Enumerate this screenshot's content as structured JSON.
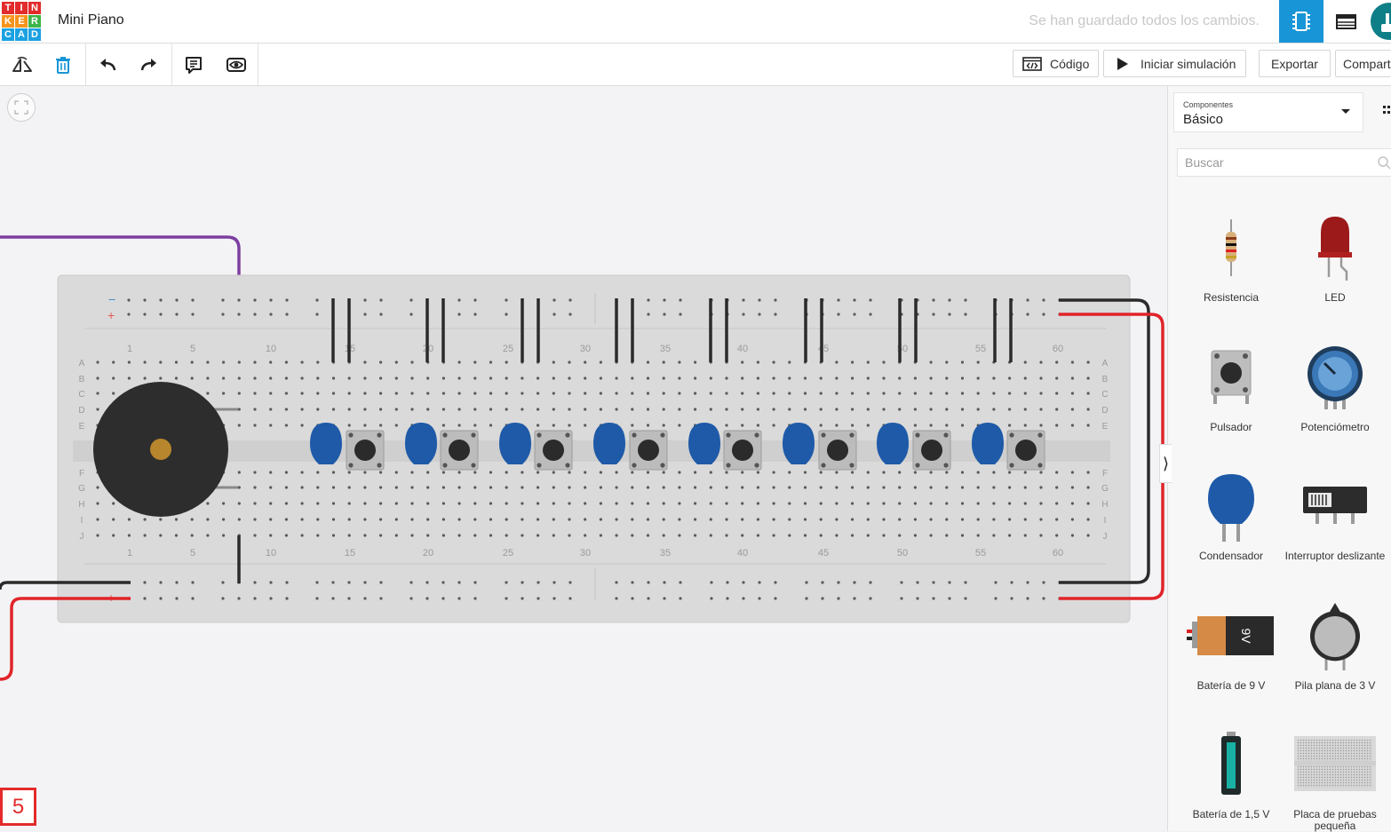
{
  "app": {
    "logo_letters": [
      "T",
      "I",
      "N",
      "K",
      "E",
      "R",
      "C",
      "A",
      "D"
    ],
    "logo_colors": [
      "#e22b2b",
      "#e22b2b",
      "#e22b2b",
      "#f7941d",
      "#f7941d",
      "#3db54a",
      "#1ba1e2",
      "#1ba1e2",
      "#1ba1e2"
    ],
    "project_title": "Mini Piano",
    "save_status": "Se han guardado todos los cambios.",
    "accent_color": "#1895d6"
  },
  "toolbar": {
    "code_label": "Código",
    "simulate_label": "Iniciar simulación",
    "export_label": "Exportar",
    "share_label": "Compart"
  },
  "panel": {
    "category_caption": "Componentes",
    "category_value": "Básico",
    "search_placeholder": "Buscar",
    "components": [
      {
        "label": "Resistencia",
        "icon": "resistor-icon"
      },
      {
        "label": "LED",
        "icon": "led-icon"
      },
      {
        "label": "Pulsador",
        "icon": "pushbutton-icon"
      },
      {
        "label": "Potenciómetro",
        "icon": "potentiometer-icon"
      },
      {
        "label": "Condensador",
        "icon": "capacitor-icon"
      },
      {
        "label": "Interruptor deslizante",
        "icon": "slide-switch-icon"
      },
      {
        "label": "Batería de 9 V",
        "icon": "battery-9v-icon"
      },
      {
        "label": "Pila plana de 3 V",
        "icon": "coin-cell-icon"
      },
      {
        "label": "Batería de 1,5 V",
        "icon": "battery-aa-icon"
      },
      {
        "label": "Placa de pruebas pequeña",
        "icon": "small-breadboard-icon"
      }
    ],
    "battery_9v_text": "9V"
  },
  "breadboard": {
    "row_letters": [
      "A",
      "B",
      "C",
      "D",
      "E",
      "F",
      "G",
      "H",
      "I",
      "J"
    ],
    "column_numbers": [
      "1",
      "5",
      "10",
      "15",
      "20",
      "25",
      "30",
      "35",
      "40",
      "45",
      "50",
      "55",
      "60"
    ],
    "rail_minus": "−",
    "rail_plus": "+"
  },
  "step_badge": "5"
}
